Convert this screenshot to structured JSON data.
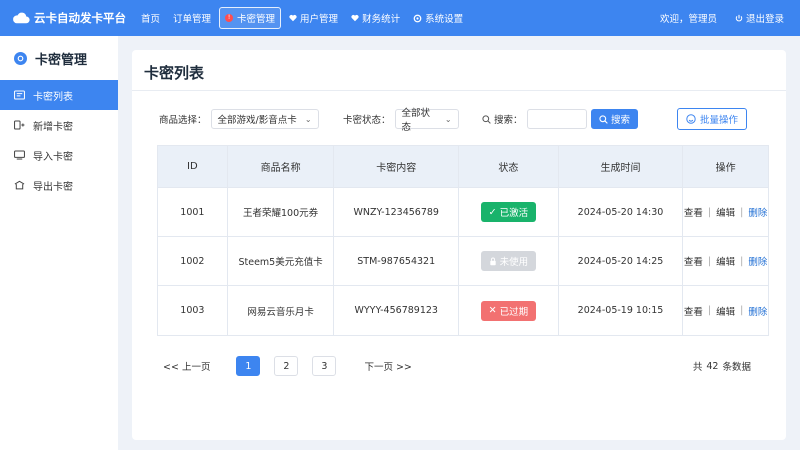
{
  "app": {
    "title": "云卡自动发卡平台"
  },
  "nav": {
    "items": [
      {
        "label": "首页"
      },
      {
        "label": "订单管理"
      },
      {
        "label": "卡密管理",
        "badge": "!"
      },
      {
        "label": "用户管理"
      },
      {
        "label": "财务统计"
      },
      {
        "label": "系统设置"
      }
    ]
  },
  "user": {
    "welcome": "欢迎，管理员",
    "logout": "退出登录"
  },
  "sidebar": {
    "title": "卡密管理",
    "items": [
      {
        "label": "卡密列表"
      },
      {
        "label": "新增卡密"
      },
      {
        "label": "导入卡密"
      },
      {
        "label": "导出卡密"
      }
    ]
  },
  "page": {
    "title": "卡密列表"
  },
  "filters": {
    "product_label": "商品选择：",
    "product_value": "全部游戏/影音点卡",
    "status_label": "卡密状态：",
    "status_value": "全部状态",
    "search_label": "搜索：",
    "search_value": "",
    "search_button": "搜索",
    "batch_button": "批量操作"
  },
  "table": {
    "headers": [
      "ID",
      "商品名称",
      "卡密内容",
      "状态",
      "生成时间",
      "操作"
    ],
    "rows": [
      {
        "id": "1001",
        "name": "王者荣耀100元券",
        "code": "WNZY-123456789",
        "status": "已激活",
        "status_type": "active",
        "time": "2024-05-20 14:30"
      },
      {
        "id": "1002",
        "name": "Steem5美元充值卡",
        "code": "STM-987654321",
        "status": "未使用",
        "status_type": "unused",
        "time": "2024-05-20 14:25"
      },
      {
        "id": "1003",
        "name": "网易云音乐月卡",
        "code": "WYYY-456789123",
        "status": "已过期",
        "status_type": "expired",
        "time": "2024-05-19 10:15"
      }
    ],
    "ops": {
      "view": "查看",
      "edit": "编辑",
      "delete": "删除"
    }
  },
  "pagination": {
    "prev": "<< 上一页",
    "pages": [
      "1",
      "2",
      "3"
    ],
    "current": "1",
    "next": "下一页 >>",
    "total_prefix": "共",
    "total_count": "42",
    "total_suffix": "条数据"
  },
  "colors": {
    "primary": "#3d85f0",
    "success": "#19b36b",
    "muted": "#d4d7dc",
    "danger": "#f27171"
  }
}
